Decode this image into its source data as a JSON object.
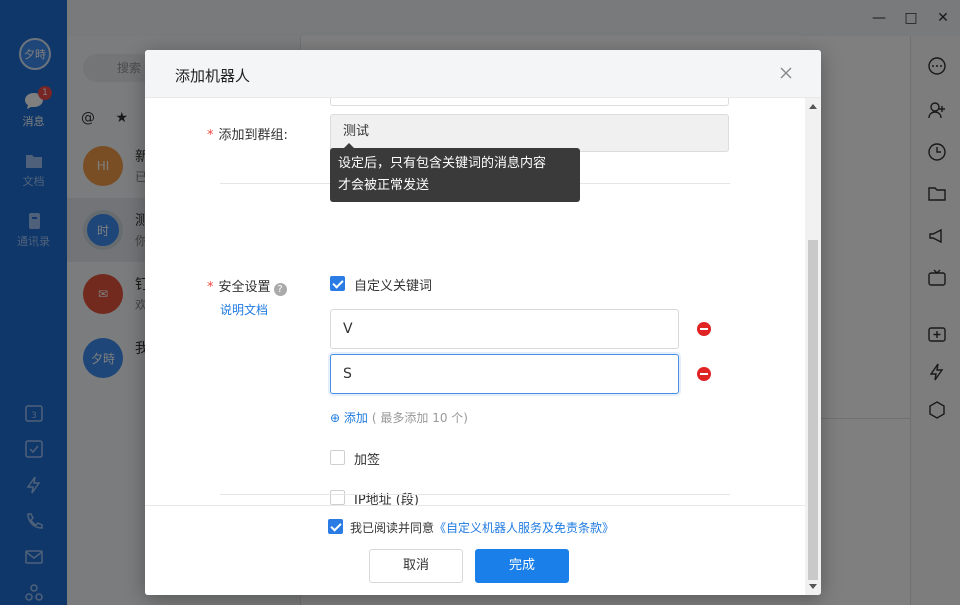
{
  "nav": {
    "avatar": "夕時",
    "messages_label": "消息",
    "messages_badge": "1",
    "docs_label": "文档",
    "contacts_label": "通讯录"
  },
  "conversations": {
    "search_placeholder": "搜索",
    "rows": [
      {
        "avatar": "HI",
        "name": "新",
        "sub": "已",
        "color": "#f29c4a"
      },
      {
        "avatar": "时",
        "name": "测",
        "sub": "你",
        "color": "#3d8df0"
      },
      {
        "avatar": "",
        "name": "钉",
        "sub": "欢",
        "color": "#e5533d"
      },
      {
        "avatar": "夕時",
        "name": "我",
        "sub": "",
        "color": "#3d8df0"
      }
    ]
  },
  "dialog": {
    "title": "添加机器人",
    "group_label": "添加到群组:",
    "group_value": "测试",
    "tooltip_line1": "设定后，只有包含关键词的消息内容",
    "tooltip_line2": "才会被正常发送",
    "security_label": "安全设置",
    "help_icon": "?",
    "doc_link": "说明文档",
    "custom_keyword_label": "自定义关键词",
    "keywords": [
      "V",
      "S"
    ],
    "add_label": "添加",
    "add_hint": "( 最多添加 10 个)",
    "sign_label": "加签",
    "ip_label": "IP地址 (段)",
    "agree_prefix": "我已阅读并同意",
    "agree_link": "《自定义机器人服务及免责条款》",
    "cancel_label": "取消",
    "confirm_label": "完成"
  },
  "colors": {
    "nav_blue": "#1f6fd4",
    "accent": "#1a7fe8",
    "danger": "#e02323",
    "required": "#e8453c"
  }
}
